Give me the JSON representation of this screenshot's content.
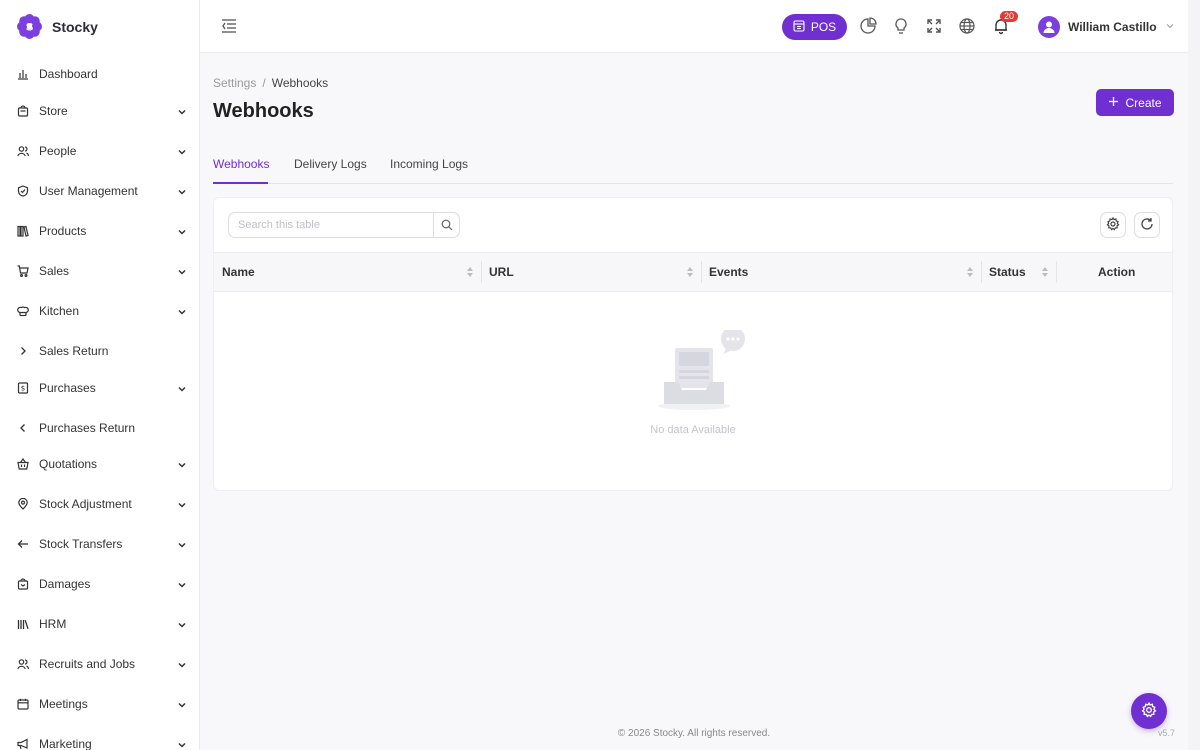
{
  "app": {
    "name": "Stocky",
    "brand_letter": "S",
    "accent": "#6f2fd1"
  },
  "sidebar": {
    "items": [
      {
        "label": "Dashboard",
        "icon": "chart-bar-icon",
        "caret": "none"
      },
      {
        "label": "Store",
        "icon": "store-icon",
        "caret": "down"
      },
      {
        "label": "People",
        "icon": "users-icon",
        "caret": "down"
      },
      {
        "label": "User Management",
        "icon": "shield-icon",
        "caret": "down"
      },
      {
        "label": "Products",
        "icon": "books-icon",
        "caret": "down"
      },
      {
        "label": "Sales",
        "icon": "cart-icon",
        "caret": "down"
      },
      {
        "label": "Kitchen",
        "icon": "chef-hat-icon",
        "caret": "down"
      },
      {
        "label": "Sales Return",
        "icon": "chevron-right-icon",
        "caret": "none"
      },
      {
        "label": "Purchases",
        "icon": "receipt-icon",
        "caret": "down"
      },
      {
        "label": "Purchases Return",
        "icon": "chevron-left-icon",
        "caret": "none"
      },
      {
        "label": "Quotations",
        "icon": "basket-icon",
        "caret": "down"
      },
      {
        "label": "Stock Adjustment",
        "icon": "map-pin-icon",
        "caret": "down"
      },
      {
        "label": "Stock Transfers",
        "icon": "arrow-left-icon",
        "caret": "down"
      },
      {
        "label": "Damages",
        "icon": "box-icon",
        "caret": "down"
      },
      {
        "label": "HRM",
        "icon": "library-icon",
        "caret": "down"
      },
      {
        "label": "Recruits and Jobs",
        "icon": "users-icon",
        "caret": "down"
      },
      {
        "label": "Meetings",
        "icon": "calendar-icon",
        "caret": "down"
      },
      {
        "label": "Marketing",
        "icon": "megaphone-icon",
        "caret": "down"
      }
    ]
  },
  "header": {
    "pos_label": "POS",
    "notification_count": "20",
    "user_name": "William Castillo"
  },
  "breadcrumb": {
    "parent": "Settings",
    "separator": "/",
    "current": "Webhooks"
  },
  "page": {
    "title": "Webhooks",
    "create_label": "Create"
  },
  "tabs": [
    {
      "label": "Webhooks",
      "active": true
    },
    {
      "label": "Delivery Logs",
      "active": false
    },
    {
      "label": "Incoming Logs",
      "active": false
    }
  ],
  "table": {
    "search_placeholder": "Search this table",
    "columns": [
      "Name",
      "URL",
      "Events",
      "Status",
      "Action"
    ],
    "empty_text": "No data Available"
  },
  "footer": {
    "copyright": "© 2026 Stocky. All rights reserved.",
    "version": "v5.7"
  }
}
